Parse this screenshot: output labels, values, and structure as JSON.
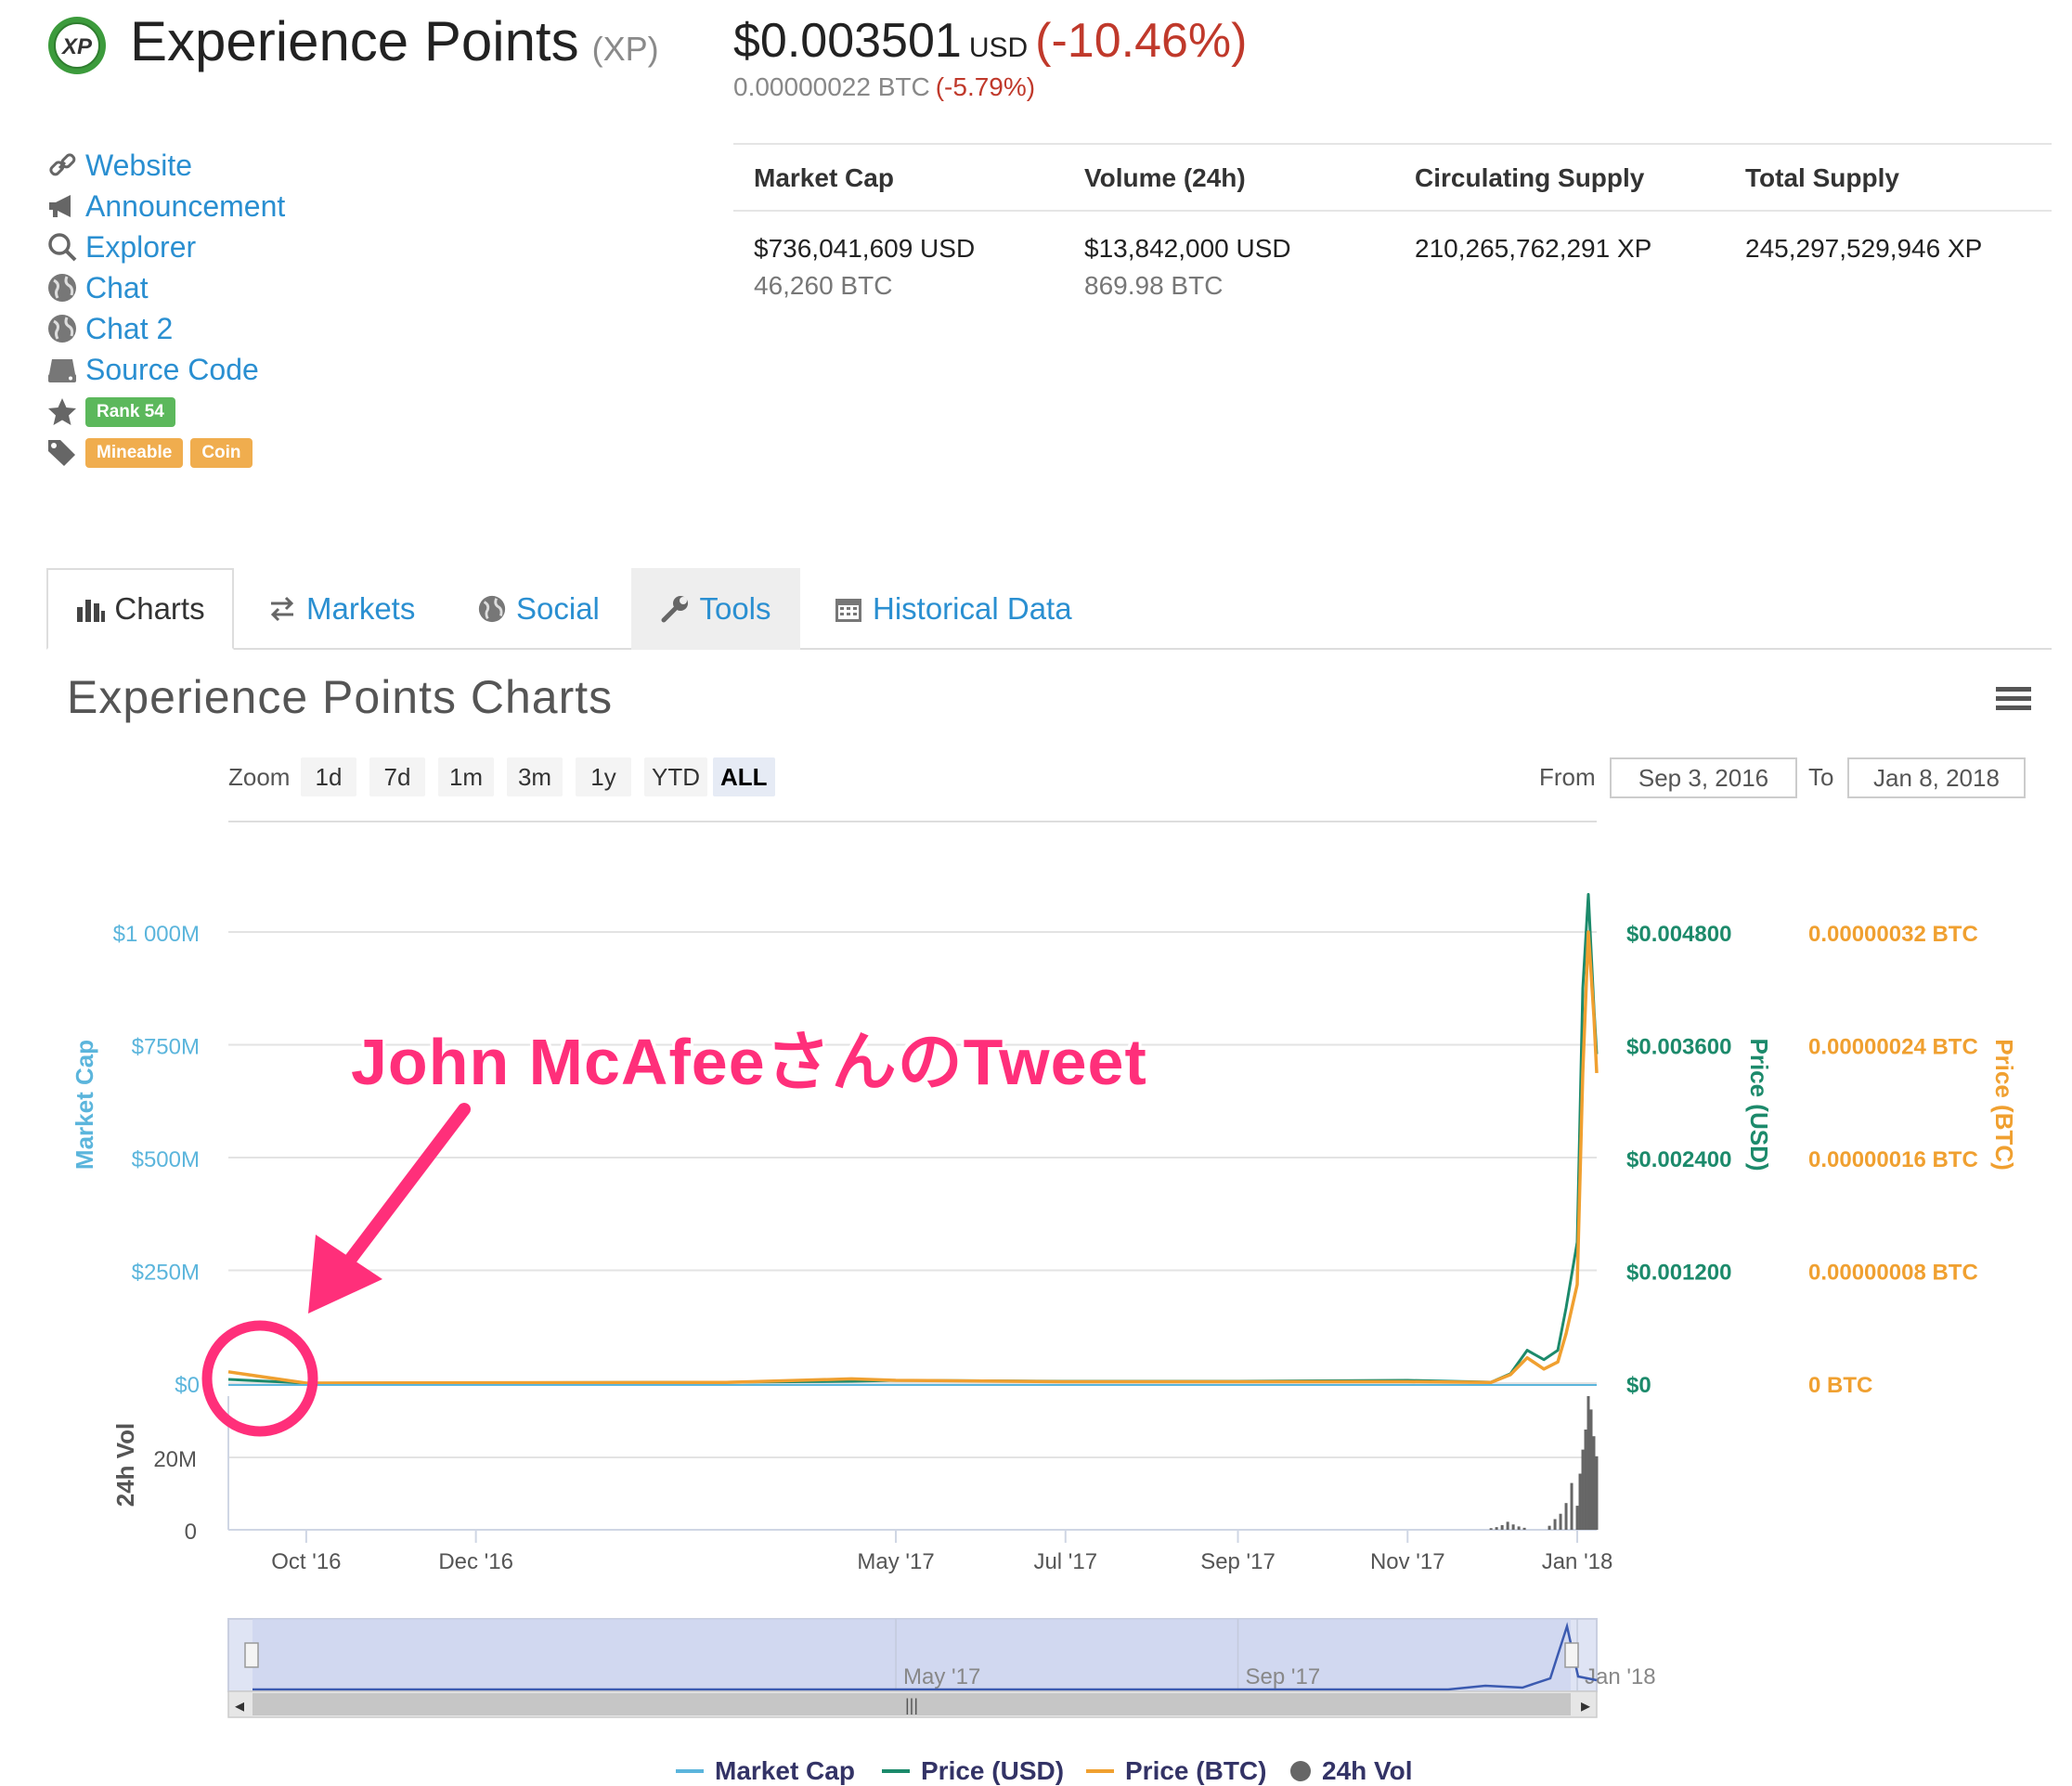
{
  "header": {
    "name": "Experience Points",
    "symbol": "(XP)",
    "price_usd": "$0.003501",
    "price_usd_currency": "USD",
    "price_usd_change": "(-10.46%)",
    "price_btc": "0.00000022 BTC",
    "price_btc_change": "(-5.79%)",
    "logo_icon": "xp-logo-icon"
  },
  "sidebar": {
    "links": [
      {
        "label": "Website",
        "icon": "link-icon"
      },
      {
        "label": "Announcement",
        "icon": "megaphone-icon"
      },
      {
        "label": "Explorer",
        "icon": "search-icon"
      },
      {
        "label": "Chat",
        "icon": "globe-icon"
      },
      {
        "label": "Chat 2",
        "icon": "globe-icon"
      },
      {
        "label": "Source Code",
        "icon": "hdd-icon"
      }
    ],
    "rank_badge": "Rank 54",
    "tags": [
      "Mineable",
      "Coin"
    ],
    "rank_color": "#5cb85c",
    "tag_color": "#f0ad4e"
  },
  "stats": {
    "headers": [
      "Market Cap",
      "Volume (24h)",
      "Circulating Supply",
      "Total Supply"
    ],
    "market_cap_usd": "$736,041,609 USD",
    "market_cap_btc": "46,260 BTC",
    "volume_usd": "$13,842,000 USD",
    "volume_btc": "869.98 BTC",
    "circulating_supply": "210,265,762,291 XP",
    "total_supply": "245,297,529,946 XP"
  },
  "tabs": [
    {
      "label": "Charts",
      "icon": "bar-chart-icon"
    },
    {
      "label": "Markets",
      "icon": "exchange-icon"
    },
    {
      "label": "Social",
      "icon": "globe-icon"
    },
    {
      "label": "Tools",
      "icon": "wrench-icon"
    },
    {
      "label": "Historical Data",
      "icon": "calendar-icon"
    }
  ],
  "chart_panel": {
    "title": "Experience Points Charts",
    "zoom_label": "Zoom",
    "zoom_options": [
      "1d",
      "7d",
      "1m",
      "3m",
      "1y",
      "YTD",
      "ALL"
    ],
    "zoom_active": "ALL",
    "from_label": "From",
    "from_value": "Sep 3, 2016",
    "to_label": "To",
    "to_value": "Jan 8, 2018"
  },
  "annotation": {
    "text": "John McAfeeさんのTweet",
    "color": "#ff2f7a"
  },
  "chart_data": {
    "type": "line",
    "left_axis": {
      "title": "Market Cap",
      "ticks": [
        "$0",
        "$250M",
        "$500M",
        "$750M",
        "$1 000M"
      ],
      "color": "#5bb5dc"
    },
    "right_axis_usd": {
      "title": "Price (USD)",
      "ticks": [
        "$0",
        "$0.001200",
        "$0.002400",
        "$0.003600",
        "$0.004800"
      ],
      "color": "#1c8a6b"
    },
    "right_axis_btc": {
      "title": "Price (BTC)",
      "ticks": [
        "0 BTC",
        "0.00000008 BTC",
        "0.00000016 BTC",
        "0.00000024 BTC",
        "0.00000032 BTC"
      ],
      "color": "#f0a030"
    },
    "volume_axis": {
      "title": "24h Vol",
      "ticks": [
        "0",
        "20M"
      ]
    },
    "x_ticks": [
      "Oct '16",
      "Dec '16",
      "May '17",
      "Jul '17",
      "Sep '17",
      "Nov '17",
      "Jan '18"
    ],
    "navigator_ticks": [
      "May '17",
      "Sep '17",
      "Jan '18"
    ],
    "series": [
      {
        "name": "Price (USD)",
        "color": "#1c8a6b",
        "x": [
          "2016-09-03",
          "2016-09-10",
          "2016-10-01",
          "2017-03-01",
          "2017-04-15",
          "2017-05-01",
          "2017-07-01",
          "2017-09-01",
          "2017-11-01",
          "2017-12-01",
          "2017-12-08",
          "2017-12-14",
          "2017-12-20",
          "2017-12-25",
          "2017-12-28",
          "2018-01-01",
          "2018-01-03",
          "2018-01-05",
          "2018-01-07",
          "2018-01-08"
        ],
        "values": [
          4e-05,
          3e-05,
          0.0,
          1e-05,
          2e-05,
          3e-05,
          2e-05,
          2e-05,
          3e-05,
          1e-05,
          0.0001,
          0.00035,
          0.00025,
          0.00035,
          0.0008,
          0.0015,
          0.0042,
          0.0052,
          0.004,
          0.0035
        ]
      },
      {
        "name": "Price (BTC)",
        "color": "#f0a030",
        "x": [
          "2016-09-03",
          "2016-09-10",
          "2016-10-01",
          "2017-03-01",
          "2017-04-15",
          "2017-05-01",
          "2017-07-01",
          "2017-09-01",
          "2017-11-01",
          "2017-12-01",
          "2017-12-08",
          "2017-12-14",
          "2017-12-20",
          "2017-12-25",
          "2017-12-28",
          "2018-01-01",
          "2018-01-03",
          "2018-01-05",
          "2018-01-07",
          "2018-01-08"
        ],
        "values": [
          8e-09,
          6e-09,
          0.0,
          5e-10,
          3e-09,
          2e-09,
          1e-09,
          1e-09,
          1e-09,
          5e-10,
          6e-09,
          1.8e-08,
          1e-08,
          1.5e-08,
          3.5e-08,
          7e-08,
          2.2e-07,
          3.2e-07,
          2.6e-07,
          2.2e-07
        ]
      }
    ],
    "legend": [
      "Market Cap",
      "Price (USD)",
      "Price (BTC)",
      "24h Vol"
    ],
    "legend_colors": [
      "#5bb5dc",
      "#1c8a6b",
      "#f0a030",
      "#666666"
    ],
    "grid": true,
    "legend_position": "bottom"
  }
}
